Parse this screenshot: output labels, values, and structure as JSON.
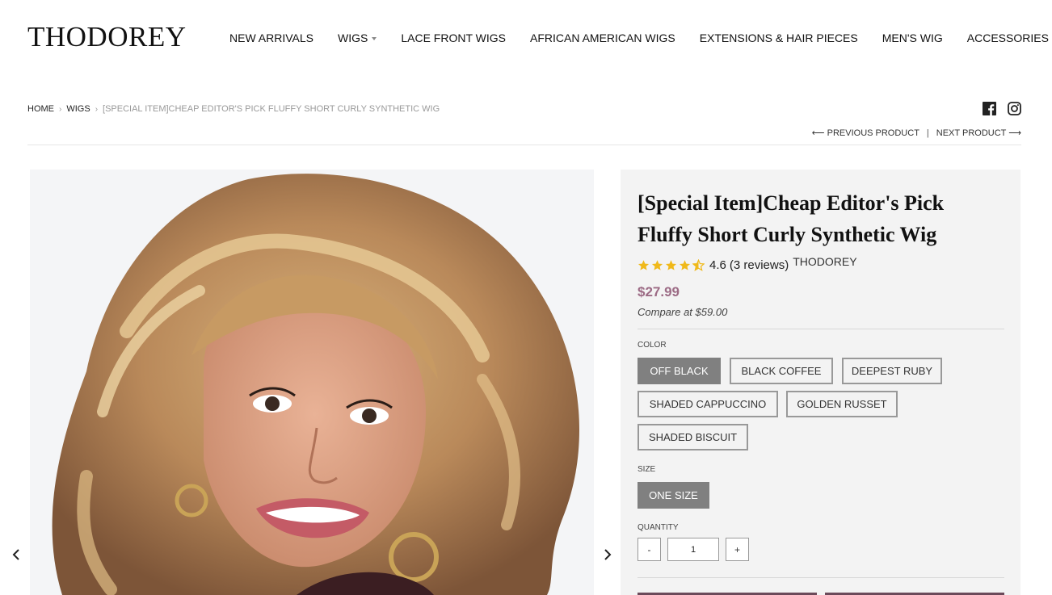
{
  "header": {
    "logo": "THODOREY",
    "nav": [
      {
        "label": "NEW ARRIVALS"
      },
      {
        "label": "WIGS",
        "dropdown": true
      },
      {
        "label": "LACE FRONT WIGS"
      },
      {
        "label": "AFRICAN AMERICAN WIGS"
      },
      {
        "label": "EXTENSIONS & HAIR PIECES"
      },
      {
        "label": "MEN'S WIG"
      },
      {
        "label": "ACCESSORIES"
      }
    ]
  },
  "breadcrumb": {
    "home": "HOME",
    "wigs": "WIGS",
    "current": "[SPECIAL ITEM]CHEAP EDITOR'S PICK FLUFFY SHORT CURLY SYNTHETIC WIG"
  },
  "social": {
    "facebook_icon": "facebook-icon",
    "instagram_icon": "instagram-icon"
  },
  "pagination": {
    "previous": "⟵ PREVIOUS PRODUCT",
    "separator": "|",
    "next": "NEXT PRODUCT ⟶"
  },
  "product": {
    "title": "[Special Item]Cheap Editor's Pick Fluffy Short Curly Synthetic Wig",
    "rating_value": "4.6",
    "rating_stars": 4.5,
    "reviews": "(3 reviews)",
    "vendor": "THODOREY",
    "price": "$27.99",
    "compare_price": "Compare at $59.00",
    "color_label": "COLOR",
    "colors": [
      "OFF BLACK",
      "BLACK COFFEE",
      "DEEPEST RUBY",
      "SHADED CAPPUCCINO",
      "GOLDEN RUSSET",
      "SHADED BISCUIT"
    ],
    "selected_color": "OFF BLACK",
    "size_label": "SIZE",
    "sizes": [
      "ONE SIZE"
    ],
    "quantity_label": "QUANTITY",
    "qty_minus": "-",
    "qty_plus": "+",
    "quantity": "1"
  },
  "colors": {
    "price": "#9c6b85",
    "star": "#f0b91a",
    "selected_swatch": "#808080"
  }
}
